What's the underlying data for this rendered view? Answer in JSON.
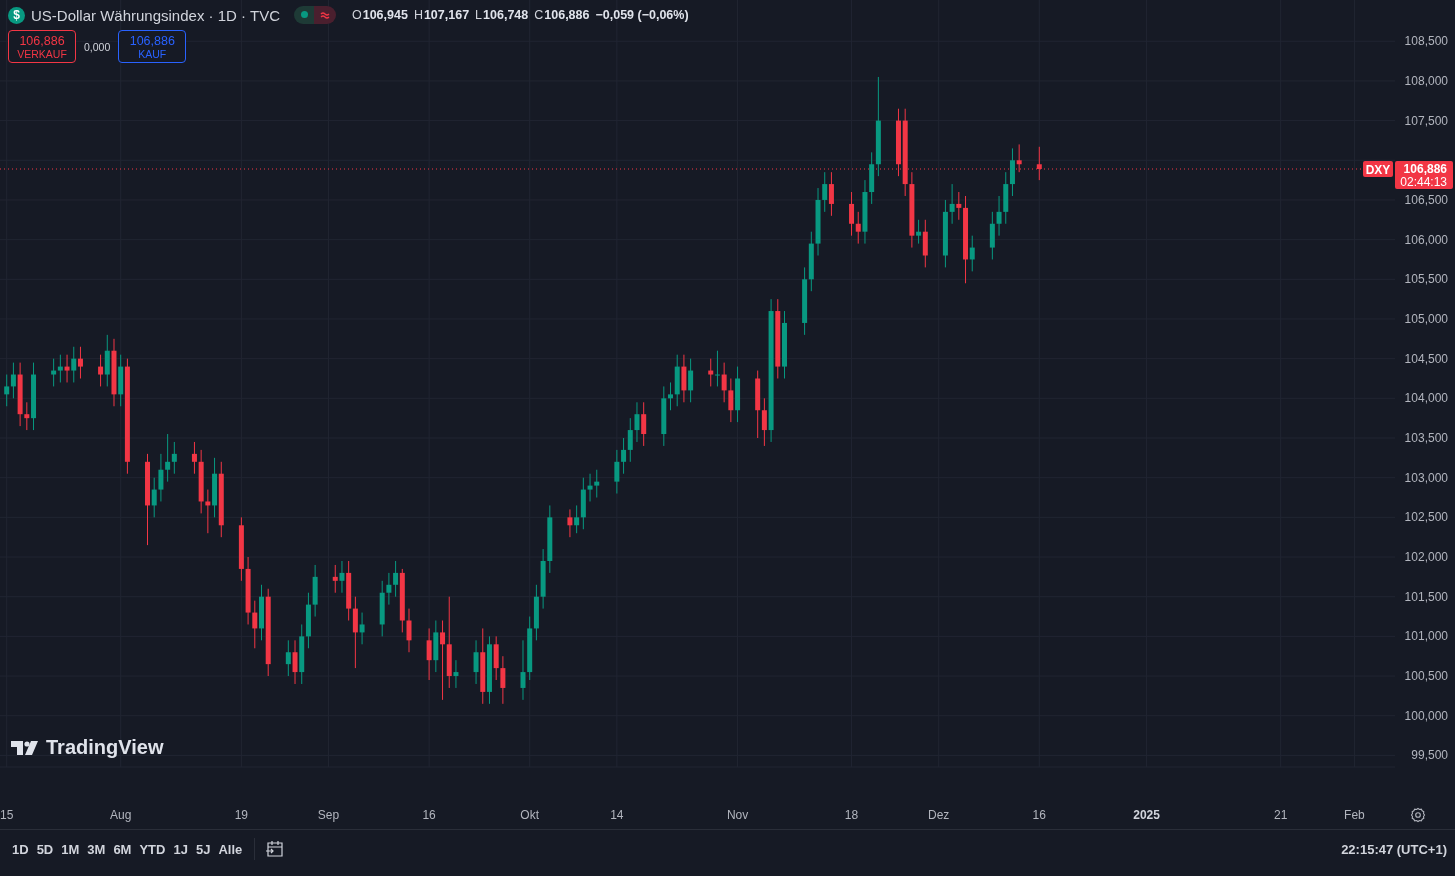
{
  "header": {
    "symbol_badge": "$",
    "title": "US-Dollar Währungsindex · 1D · TVC",
    "ohlc": [
      {
        "label": "O",
        "value": "106,945"
      },
      {
        "label": "H",
        "value": "107,167"
      },
      {
        "label": "L",
        "value": "106,748"
      },
      {
        "label": "C",
        "value": "106,886"
      }
    ],
    "change": "−0,059 (−0,06%)"
  },
  "trade": {
    "sell": {
      "price": "106,886",
      "label": "VERKAUF"
    },
    "spread": "0,000",
    "buy": {
      "price": "106,886",
      "label": "KAUF"
    }
  },
  "current_price": {
    "symbol": "DXY",
    "price": "106,886",
    "countdown": "02:44:13"
  },
  "logo": "TradingView",
  "chart": {
    "chart_data": {
      "type": "candlestick",
      "x": [
        "2024-07-15",
        "2024-07-16",
        "2024-07-17",
        "2024-07-18",
        "2024-07-19",
        "2024-07-22",
        "2024-07-23",
        "2024-07-24",
        "2024-07-25",
        "2024-07-26",
        "2024-07-29",
        "2024-07-30",
        "2024-07-31",
        "2024-08-01",
        "2024-08-02",
        "2024-08-05",
        "2024-08-06",
        "2024-08-07",
        "2024-08-08",
        "2024-08-09",
        "2024-08-12",
        "2024-08-13",
        "2024-08-14",
        "2024-08-15",
        "2024-08-16",
        "2024-08-19",
        "2024-08-20",
        "2024-08-21",
        "2024-08-22",
        "2024-08-23",
        "2024-08-26",
        "2024-08-27",
        "2024-08-28",
        "2024-08-29",
        "2024-08-30",
        "2024-09-02",
        "2024-09-03",
        "2024-09-04",
        "2024-09-05",
        "2024-09-06",
        "2024-09-09",
        "2024-09-10",
        "2024-09-11",
        "2024-09-12",
        "2024-09-13",
        "2024-09-16",
        "2024-09-17",
        "2024-09-18",
        "2024-09-19",
        "2024-09-20",
        "2024-09-23",
        "2024-09-24",
        "2024-09-25",
        "2024-09-26",
        "2024-09-27",
        "2024-09-30",
        "2024-10-01",
        "2024-10-02",
        "2024-10-03",
        "2024-10-04",
        "2024-10-07",
        "2024-10-08",
        "2024-10-09",
        "2024-10-10",
        "2024-10-11",
        "2024-10-14",
        "2024-10-15",
        "2024-10-16",
        "2024-10-17",
        "2024-10-18",
        "2024-10-21",
        "2024-10-22",
        "2024-10-23",
        "2024-10-24",
        "2024-10-25",
        "2024-10-28",
        "2024-10-29",
        "2024-10-30",
        "2024-10-31",
        "2024-11-01",
        "2024-11-04",
        "2024-11-05",
        "2024-11-06",
        "2024-11-07",
        "2024-11-08",
        "2024-11-11",
        "2024-11-12",
        "2024-11-13",
        "2024-11-14",
        "2024-11-15",
        "2024-11-18",
        "2024-11-19",
        "2024-11-20",
        "2024-11-21",
        "2024-11-22",
        "2024-11-25",
        "2024-11-26",
        "2024-11-27",
        "2024-11-28",
        "2024-11-29",
        "2024-12-02",
        "2024-12-03",
        "2024-12-04",
        "2024-12-05",
        "2024-12-06",
        "2024-12-09",
        "2024-12-10",
        "2024-12-11",
        "2024-12-12",
        "2024-12-13",
        "2024-12-16"
      ],
      "ohlc": [
        [
          104.05,
          104.3,
          103.9,
          104.15
        ],
        [
          104.15,
          104.45,
          104.0,
          104.3
        ],
        [
          104.3,
          104.45,
          103.65,
          103.8
        ],
        [
          103.8,
          103.95,
          103.6,
          103.75
        ],
        [
          103.75,
          104.45,
          103.6,
          104.3
        ],
        [
          104.3,
          104.5,
          104.15,
          104.35
        ],
        [
          104.35,
          104.55,
          104.2,
          104.4
        ],
        [
          104.4,
          104.55,
          104.2,
          104.35
        ],
        [
          104.35,
          104.65,
          104.2,
          104.5
        ],
        [
          104.5,
          104.65,
          104.25,
          104.4
        ],
        [
          104.4,
          104.55,
          104.15,
          104.3
        ],
        [
          104.3,
          104.8,
          104.15,
          104.6
        ],
        [
          104.6,
          104.75,
          103.9,
          104.05
        ],
        [
          104.05,
          104.55,
          103.9,
          104.4
        ],
        [
          104.4,
          104.5,
          103.05,
          103.2
        ],
        [
          103.2,
          103.3,
          102.15,
          102.65
        ],
        [
          102.65,
          103.0,
          102.5,
          102.85
        ],
        [
          102.85,
          103.3,
          102.7,
          103.1
        ],
        [
          103.1,
          103.55,
          102.95,
          103.2
        ],
        [
          103.2,
          103.45,
          103.05,
          103.3
        ],
        [
          103.3,
          103.45,
          103.05,
          103.2
        ],
        [
          103.2,
          103.35,
          102.55,
          102.7
        ],
        [
          102.7,
          102.85,
          102.3,
          102.65
        ],
        [
          102.65,
          103.25,
          102.5,
          103.05
        ],
        [
          103.05,
          103.2,
          102.25,
          102.4
        ],
        [
          102.4,
          102.5,
          101.7,
          101.85
        ],
        [
          101.85,
          102.0,
          101.15,
          101.3
        ],
        [
          101.3,
          101.45,
          100.85,
          101.1
        ],
        [
          101.1,
          101.65,
          100.95,
          101.5
        ],
        [
          101.5,
          101.6,
          100.5,
          100.65
        ],
        [
          100.65,
          100.95,
          100.5,
          100.8
        ],
        [
          100.8,
          100.95,
          100.4,
          100.55
        ],
        [
          100.55,
          101.15,
          100.4,
          101.0
        ],
        [
          101.0,
          101.55,
          100.85,
          101.4
        ],
        [
          101.4,
          101.9,
          101.25,
          101.75
        ],
        [
          101.75,
          101.9,
          101.55,
          101.7
        ],
        [
          101.7,
          101.95,
          101.55,
          101.8
        ],
        [
          101.8,
          101.95,
          101.2,
          101.35
        ],
        [
          101.35,
          101.5,
          100.6,
          101.05
        ],
        [
          101.05,
          101.3,
          100.9,
          101.15
        ],
        [
          101.15,
          101.7,
          101.0,
          101.55
        ],
        [
          101.55,
          101.8,
          101.4,
          101.65
        ],
        [
          101.65,
          101.95,
          101.5,
          101.8
        ],
        [
          101.8,
          101.85,
          101.05,
          101.2
        ],
        [
          101.2,
          101.35,
          100.8,
          100.95
        ],
        [
          100.95,
          101.1,
          100.45,
          100.7
        ],
        [
          100.7,
          101.2,
          100.55,
          101.05
        ],
        [
          101.05,
          101.2,
          100.2,
          100.9
        ],
        [
          100.9,
          101.5,
          100.35,
          100.5
        ],
        [
          100.5,
          100.7,
          100.35,
          100.55
        ],
        [
          100.55,
          100.95,
          100.4,
          100.8
        ],
        [
          100.8,
          101.1,
          100.15,
          100.3
        ],
        [
          100.3,
          101.0,
          100.15,
          100.9
        ],
        [
          100.9,
          101.0,
          100.45,
          100.6
        ],
        [
          100.6,
          100.75,
          100.15,
          100.35
        ],
        [
          100.35,
          100.95,
          100.2,
          100.55
        ],
        [
          100.55,
          101.25,
          100.45,
          101.1
        ],
        [
          101.1,
          101.65,
          100.95,
          101.5
        ],
        [
          101.5,
          102.1,
          101.35,
          101.95
        ],
        [
          101.95,
          102.65,
          101.8,
          102.5
        ],
        [
          102.5,
          102.6,
          102.25,
          102.4
        ],
        [
          102.4,
          102.65,
          102.3,
          102.5
        ],
        [
          102.5,
          103.0,
          102.35,
          102.85
        ],
        [
          102.85,
          103.05,
          102.7,
          102.9
        ],
        [
          102.9,
          103.1,
          102.75,
          102.95
        ],
        [
          102.95,
          103.35,
          102.8,
          103.2
        ],
        [
          103.2,
          103.5,
          103.05,
          103.35
        ],
        [
          103.35,
          103.75,
          103.2,
          103.6
        ],
        [
          103.6,
          103.95,
          103.45,
          103.8
        ],
        [
          103.8,
          103.95,
          103.4,
          103.55
        ],
        [
          103.55,
          104.15,
          103.4,
          104.0
        ],
        [
          104.0,
          104.2,
          103.85,
          104.05
        ],
        [
          104.05,
          104.55,
          103.9,
          104.4
        ],
        [
          104.4,
          104.55,
          103.95,
          104.1
        ],
        [
          104.1,
          104.5,
          103.95,
          104.35
        ],
        [
          104.35,
          104.5,
          104.15,
          104.3
        ],
        [
          104.3,
          104.6,
          104.15,
          104.3
        ],
        [
          104.3,
          104.45,
          103.95,
          104.1
        ],
        [
          104.1,
          104.25,
          103.7,
          103.85
        ],
        [
          103.85,
          104.4,
          103.7,
          104.25
        ],
        [
          104.25,
          104.35,
          103.5,
          103.85
        ],
        [
          103.85,
          104.0,
          103.4,
          103.6
        ],
        [
          103.6,
          105.25,
          103.45,
          105.1
        ],
        [
          105.1,
          105.25,
          104.25,
          104.4
        ],
        [
          104.4,
          105.1,
          104.25,
          104.95
        ],
        [
          104.95,
          105.65,
          104.8,
          105.5
        ],
        [
          105.5,
          106.1,
          105.35,
          105.95
        ],
        [
          105.95,
          106.65,
          105.8,
          106.5
        ],
        [
          106.5,
          106.85,
          106.35,
          106.7
        ],
        [
          106.7,
          106.85,
          106.3,
          106.45
        ],
        [
          106.45,
          106.6,
          106.05,
          106.2
        ],
        [
          106.2,
          106.35,
          105.95,
          106.1
        ],
        [
          106.1,
          106.75,
          105.95,
          106.6
        ],
        [
          106.6,
          107.1,
          106.45,
          106.95
        ],
        [
          106.95,
          108.05,
          106.8,
          107.5
        ],
        [
          107.5,
          107.65,
          106.8,
          106.95
        ],
        [
          107.5,
          107.65,
          106.55,
          106.7
        ],
        [
          106.7,
          106.85,
          105.9,
          106.05
        ],
        [
          106.05,
          106.25,
          105.95,
          106.1
        ],
        [
          106.1,
          106.25,
          105.65,
          105.8
        ],
        [
          105.8,
          106.5,
          105.65,
          106.35
        ],
        [
          106.35,
          106.7,
          106.2,
          106.45
        ],
        [
          106.45,
          106.6,
          106.25,
          106.4
        ],
        [
          106.4,
          106.55,
          105.45,
          105.75
        ],
        [
          105.75,
          106.05,
          105.6,
          105.9
        ],
        [
          105.9,
          106.35,
          105.75,
          106.2
        ],
        [
          106.2,
          106.55,
          106.05,
          106.35
        ],
        [
          106.35,
          106.85,
          106.2,
          106.7
        ],
        [
          106.7,
          107.15,
          106.55,
          107.0
        ],
        [
          107.0,
          107.2,
          106.85,
          106.95
        ],
        [
          106.95,
          107.17,
          106.75,
          106.89
        ]
      ],
      "grid": true,
      "ref_lines": [
        {
          "axis": "y",
          "value": 106.89,
          "color": "#f23645"
        }
      ],
      "xlim": [
        "2024-07-14",
        "2025-02-16"
      ],
      "ylim": [
        97.98,
        109.02
      ],
      "xticks": [
        {
          "value": "2024-07-15",
          "label": "15"
        },
        {
          "value": "2024-08-01",
          "label": "Aug"
        },
        {
          "value": "2024-08-19",
          "label": "19"
        },
        {
          "value": "2024-09-01",
          "label": "Sep"
        },
        {
          "value": "2024-09-16",
          "label": "16"
        },
        {
          "value": "2024-10-01",
          "label": "Okt"
        },
        {
          "value": "2024-10-14",
          "label": "14"
        },
        {
          "value": "2024-11-01",
          "label": "Nov"
        },
        {
          "value": "2024-11-18",
          "label": "18"
        },
        {
          "value": "2024-12-01",
          "label": "Dez"
        },
        {
          "value": "2024-12-16",
          "label": "16"
        },
        {
          "value": "2025-01-01",
          "label": "2025"
        },
        {
          "value": "2025-01-21",
          "label": "21"
        },
        {
          "value": "2025-02-01",
          "label": "Feb"
        }
      ],
      "yticks": [
        {
          "value": 108.5,
          "label": "108,500"
        },
        {
          "value": 108,
          "label": "108,000"
        },
        {
          "value": 107.5,
          "label": "107,500"
        },
        {
          "value": 106.5,
          "label": "106,500"
        },
        {
          "value": 106,
          "label": "106,000"
        },
        {
          "value": 105.5,
          "label": "105,500"
        },
        {
          "value": 105,
          "label": "105,000"
        },
        {
          "value": 104.5,
          "label": "104,500"
        },
        {
          "value": 104,
          "label": "104,000"
        },
        {
          "value": 103.5,
          "label": "103,500"
        },
        {
          "value": 103,
          "label": "103,000"
        },
        {
          "value": 102.5,
          "label": "102,500"
        },
        {
          "value": 102,
          "label": "102,000"
        },
        {
          "value": 101.5,
          "label": "101,500"
        },
        {
          "value": 101,
          "label": "101,000"
        },
        {
          "value": 100.5,
          "label": "100,500"
        },
        {
          "value": 100,
          "label": "100,000"
        },
        {
          "value": 99.5,
          "label": "99,500"
        }
      ]
    }
  },
  "ranges": [
    {
      "label": "1D"
    },
    {
      "label": "5D"
    },
    {
      "label": "1M"
    },
    {
      "label": "3M"
    },
    {
      "label": "6M"
    },
    {
      "label": "YTD"
    },
    {
      "label": "1J"
    },
    {
      "label": "5J"
    },
    {
      "label": "Alle"
    }
  ],
  "clock": "22:15:47 (UTC+1)"
}
